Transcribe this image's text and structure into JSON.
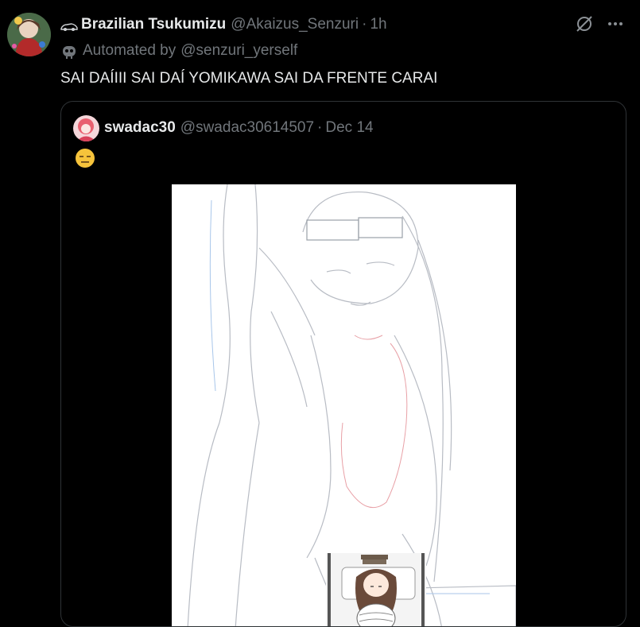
{
  "tweet": {
    "display_name": "Brazilian Tsukumizu",
    "handle": "@Akaizus_Senzuri",
    "separator": "·",
    "time": "1h",
    "automated_label": "Automated by",
    "automated_by": "@senzuri_yerself",
    "text": "SAI DAÍIII SAI DAÍ YOMIKAWA SAI DA FRENTE CARAI"
  },
  "quoted": {
    "display_name": "swadac30",
    "handle": "@swadac30614507",
    "separator": "·",
    "time": "Dec 14",
    "emoji": "expressionless-face"
  },
  "icons": {
    "prefix": "car-emoji",
    "automated": "robot-icon",
    "grok": "grok-icon",
    "more": "more-icon"
  },
  "colors": {
    "background": "#000000",
    "text": "#e7e9ea",
    "muted": "#71767b",
    "border": "#2f3336"
  }
}
